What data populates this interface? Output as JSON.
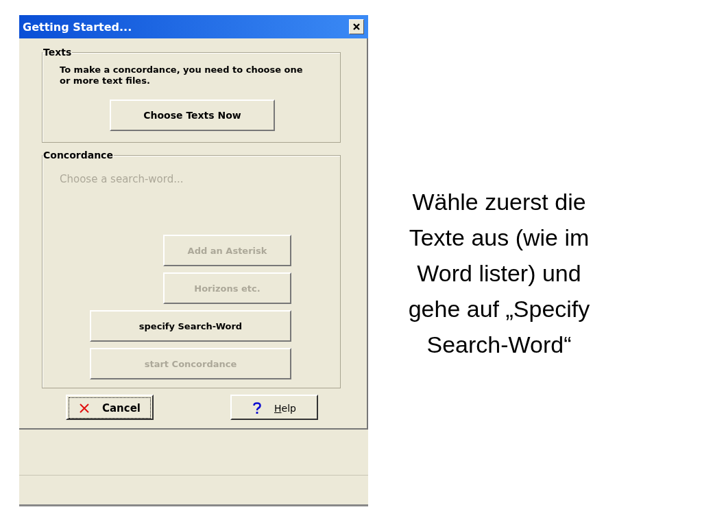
{
  "window": {
    "title": "Getting Started..."
  },
  "texts_group": {
    "title": "Texts",
    "description": "To make a concordance, you need to choose one or more text files.",
    "button": {
      "label": "Choose Texts Now",
      "disabled": false
    }
  },
  "concordance_group": {
    "title": "Concordance",
    "prompt": "Choose a search-word...",
    "prompt_disabled": true,
    "buttons": [
      {
        "label": "Add an Asterisk",
        "disabled": true,
        "wide": false
      },
      {
        "label": "Horizons etc.",
        "disabled": true,
        "wide": false
      },
      {
        "label": "specify Search-Word",
        "disabled": false,
        "wide": true
      },
      {
        "label": "start Concordance",
        "disabled": true,
        "wide": true
      }
    ]
  },
  "footer_buttons": [
    {
      "kind": "cancel",
      "label": "Cancel",
      "focused": true,
      "mnemonic": false
    },
    {
      "kind": "help",
      "label": "Help",
      "focused": false,
      "mnemonic": true
    }
  ],
  "caption": "Wähle zuerst die Texte aus (wie im Word lister) und gehe auf „Specify Search-Word“"
}
